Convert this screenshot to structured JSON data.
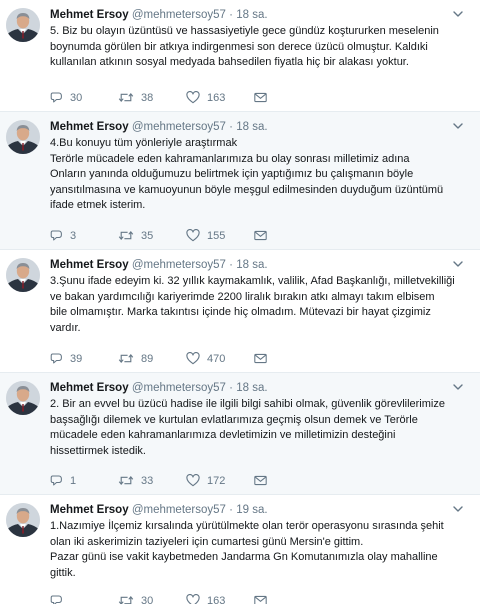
{
  "tweets": [
    {
      "name": "Mehmet Ersoy",
      "handle": "@mehmetersoy57",
      "time": "18 sa.",
      "lines": [
        "5. Biz bu olayın üzüntüsü ve hassasiyetiyle gece gündüz koştururken meselenin",
        "boynumda görülen bir atkıya indirgenmesi son derece üzücü olmuştur. Kaldıki",
        "kullanılan atkının sosyal medyada bahsedilen fiyatla hiç bir alakası yoktur."
      ],
      "replies": "30",
      "retweets": "38",
      "likes": "163"
    },
    {
      "name": "Mehmet Ersoy",
      "handle": "@mehmetersoy57",
      "time": "18 sa.",
      "lines": [
        "4.Bu konuyu tüm yönleriyle araştırmak",
        "Terörle mücadele eden kahramanlarımıza bu olay sonrası milletimiz adına",
        "Onların yanında olduğumuzu belirtmek için yaptığımız bu çalışmanın böyle",
        "yansıtılmasına ve kamuoyunun böyle meşgul edilmesinden duyduğum üzüntümü",
        "ifade etmek isterim."
      ],
      "replies": "3",
      "retweets": "35",
      "likes": "155"
    },
    {
      "name": "Mehmet Ersoy",
      "handle": "@mehmetersoy57",
      "time": "18 sa.",
      "lines": [
        "3.Şunu ifade edeyim ki. 32 yıllık kaymakamlık, valilik, Afad Başkanlığı, milletvekilliği",
        "ve bakan yardımcılığı kariyerimde 2200 liralık bırakın atkı almayı takım elbisem",
        "bile  olmamıştır. Marka takıntısı içinde hiç olmadım. Mütevazi bir hayat çizgimiz",
        "vardır."
      ],
      "replies": "39",
      "retweets": "89",
      "likes": "470"
    },
    {
      "name": "Mehmet Ersoy",
      "handle": "@mehmetersoy57",
      "time": "18 sa.",
      "lines": [
        "2. Bir an evvel bu üzücü hadise ile ilgili bilgi sahibi olmak, güvenlik görevlilerimize",
        "başsağlığı dilemek ve kurtulan evlatlarımıza geçmiş olsun demek ve Terörle",
        "mücadele eden kahramanlarımıza devletimizin ve milletimizin desteğini",
        "hissettirmek istedik."
      ],
      "replies": "1",
      "retweets": "33",
      "likes": "172"
    },
    {
      "name": "Mehmet Ersoy",
      "handle": "@mehmetersoy57",
      "time": "19 sa.",
      "lines": [
        "1.Nazımiye İlçemiz kırsalında yürütülmekte olan terör operasyonu sırasında şehit",
        "olan iki askerimizin taziyeleri için cumartesi günü Mersin'e gittim.",
        "Pazar günü ise  vakit kaybetmeden Jandarma Gn Komutanımızla olay mahalline",
        "gittik."
      ],
      "replies": "",
      "retweets": "30",
      "likes": "163"
    }
  ],
  "colors": {
    "text": "#14171a",
    "muted": "#657786",
    "divider": "#e6ecf0",
    "alt_bg": "#f5f8fa"
  },
  "icons": {
    "reply": "reply-icon",
    "retweet": "retweet-icon",
    "like": "heart-icon",
    "message": "envelope-icon",
    "menu": "chevron-down-icon"
  }
}
